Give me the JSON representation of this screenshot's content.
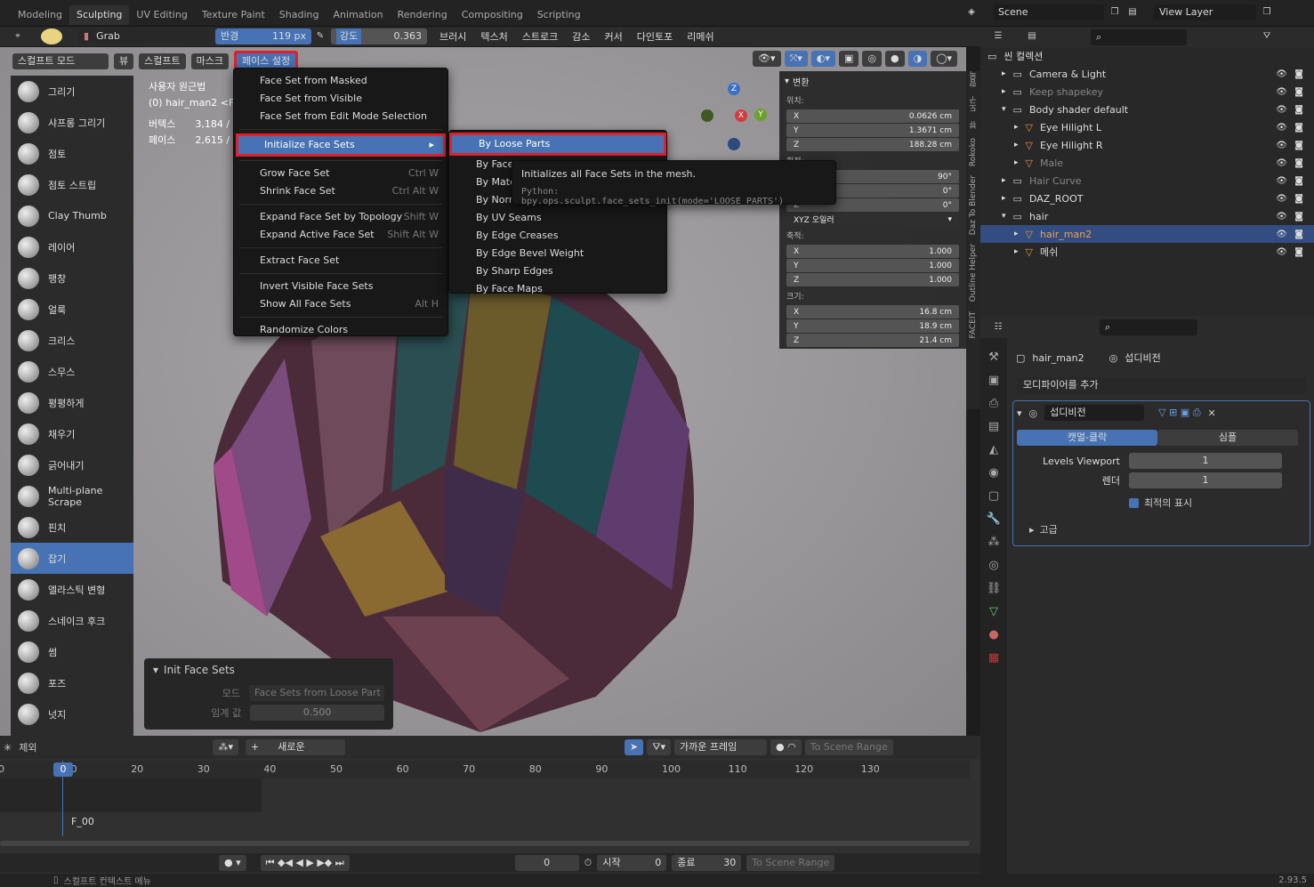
{
  "workspaces": [
    "Modeling",
    "Sculpting",
    "UV Editing",
    "Texture Paint",
    "Shading",
    "Animation",
    "Rendering",
    "Compositing",
    "Scripting"
  ],
  "scene": "Scene",
  "view_layer": "View Layer",
  "brush": {
    "name": "Grab",
    "radius_label": "반경",
    "radius": "119 px",
    "strength_label": "강도",
    "strength": "0.363"
  },
  "header_menus": [
    "브러시",
    "텍스처",
    "스트로크",
    "감소",
    "커서",
    "다인토포",
    "리메쉬"
  ],
  "axes": [
    "X",
    "Y",
    "Z"
  ],
  "mode_bar": {
    "mode": "스컬프트 모드",
    "items": [
      "뷰",
      "스컬프트",
      "마스크",
      "페이스 설정"
    ]
  },
  "viewport_info": {
    "line1": "사용자 원근법",
    "line2": "(0) hair_man2 <F",
    "vert_label": "버텍스",
    "vert": "3,184 /",
    "face_label": "페이스",
    "face": "2,615 /"
  },
  "tools": [
    "그리기",
    "샤프롱 그리기",
    "점토",
    "점토 스트립",
    "Clay Thumb",
    "레이어",
    "팽창",
    "얼룩",
    "크리스",
    "스무스",
    "평평하게",
    "채우기",
    "긁어내기",
    "Multi-plane Scrape",
    "핀치",
    "잡기",
    "엘라스틱 변형",
    "스네이크 후크",
    "썸",
    "포즈",
    "넛지"
  ],
  "face_menu": {
    "g1": [
      "Face Set from Masked",
      "Face Set from Visible",
      "Face Set from Edit Mode Selection"
    ],
    "init": "Initialize Face Sets",
    "g2": [
      {
        "l": "Grow Face Set",
        "s": "Ctrl W"
      },
      {
        "l": "Shrink Face Set",
        "s": "Ctrl Alt W"
      }
    ],
    "g3": [
      {
        "l": "Expand Face Set by Topology",
        "s": "Shift W"
      },
      {
        "l": "Expand Active Face Set",
        "s": "Shift Alt W"
      }
    ],
    "g4": [
      "Extract Face Set"
    ],
    "g5": [
      {
        "l": "Invert Visible Face Sets",
        "s": ""
      },
      {
        "l": "Show All Face Sets",
        "s": "Alt H"
      }
    ],
    "g6": [
      "Randomize Colors"
    ]
  },
  "submenu": [
    "By Loose Parts",
    "By Face Set Boundaries",
    "By Material",
    "By Normals",
    "By UV Seams",
    "By Edge Creases",
    "By Edge Bevel Weight",
    "By Sharp Edges",
    "By Face Maps"
  ],
  "tooltip": {
    "desc": "Initializes all Face Sets in the mesh.",
    "python": "Python: bpy.ops.sculpt.face_sets_init(mode='LOOSE_PARTS')"
  },
  "npanel": {
    "title": "변환",
    "loc_label": "위치:",
    "loc": [
      "0.0626 cm",
      "1.3671 cm",
      "188.28 cm"
    ],
    "rot_label": "회전:",
    "rot": [
      "90°",
      "0°",
      "0°"
    ],
    "rot_mode": "XYZ 오일러",
    "scale_label": "축적:",
    "scale": [
      "1.000",
      "1.000",
      "1.000"
    ],
    "dim_label": "크기:",
    "dim": [
      "16.8 cm",
      "18.9 cm",
      "21.4 cm"
    ]
  },
  "side_tabs": [
    "항목",
    "도구",
    "뷰",
    "Rokoko",
    "Daz To Blender",
    "Outline Helper",
    "FACEIT"
  ],
  "redo": {
    "title": "Init Face Sets",
    "mode_label": "모드",
    "mode": "Face Sets from Loose Part",
    "thr_label": "임계 값",
    "thr": "0.500"
  },
  "outliner": {
    "root": "씬 컬렉션",
    "rows": [
      "Camera & Light",
      "Keep shapekey",
      "Body shader default",
      "Eye Hilight L",
      "Eye Hilight R",
      "Male",
      "Hair Curve",
      "DAZ_ROOT",
      "hair",
      "hair_man2",
      "메쉬"
    ]
  },
  "props": {
    "obj": "hair_man2",
    "mod": "섭디비전",
    "add": "모디파이어를 추가",
    "mod_name": "섭디비전",
    "tab1": "캣멀-클락",
    "tab2": "심플",
    "lv_label": "Levels Viewport",
    "lv": "1",
    "render_label": "렌더",
    "render": "1",
    "opt": "최적의 표시",
    "adv": "고급"
  },
  "timeline": {
    "exclude": "제외",
    "new": "새로운",
    "ticks": [
      "0",
      "10",
      "20",
      "30",
      "40",
      "50",
      "60",
      "70",
      "80",
      "90",
      "100",
      "110",
      "120",
      "130"
    ],
    "frame": "0",
    "snap": "가까운 프레임",
    "range": "To Scene Range",
    "marker": "F_00",
    "cur": "0",
    "start_label": "시작",
    "start": "0",
    "end_label": "종료",
    "end": "30"
  },
  "status": {
    "ctx": "스컬프트 컨텍스트 메뉴",
    "ver": "2.93.5"
  },
  "colors": {
    "accent": "#4772b3",
    "red": "#e0202a"
  }
}
